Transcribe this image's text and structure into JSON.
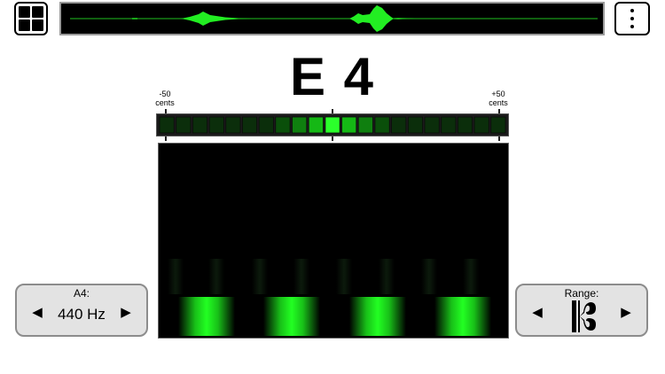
{
  "toolbar": {
    "layout_icon": "grid-layout-icon",
    "more_icon": "vertical-ellipsis-icon"
  },
  "tuner": {
    "note": "E 4",
    "cents_left": [
      "-50",
      "cents"
    ],
    "cents_right": [
      "+50",
      "cents"
    ],
    "meter_segments": 21,
    "meter_active_segment": 10
  },
  "a4_panel": {
    "title": "A4:",
    "value": "440 Hz",
    "left_arrow": "◀",
    "right_arrow": "▶"
  },
  "range_panel": {
    "title": "Range:",
    "clef_icon": "alto-clef-icon",
    "left_arrow": "◀",
    "right_arrow": "▶"
  },
  "colors": {
    "accent_green": "#22ff22",
    "background": "#ffffff",
    "panel_bg": "#e3e3e3"
  }
}
